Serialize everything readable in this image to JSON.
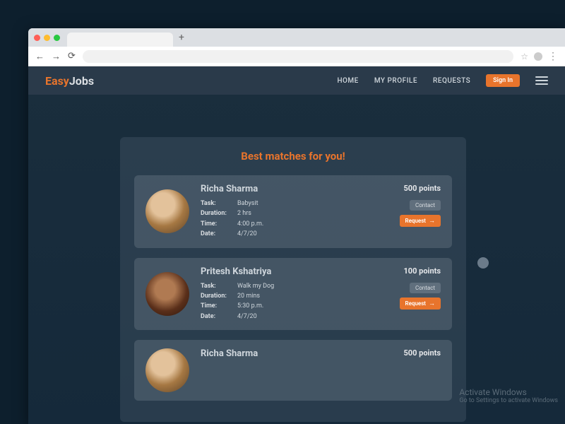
{
  "browser": {
    "new_tab_glyph": "+",
    "back": "←",
    "fwd": "→",
    "reload": "⟳",
    "star": "☆",
    "kebab": "⋮"
  },
  "nav": {
    "logo_easy": "Easy",
    "logo_jobs": "Jobs",
    "links": [
      "HOME",
      "MY PROFILE",
      "REQUESTS"
    ],
    "signin": "Sign In"
  },
  "headline": "Best matches for you!",
  "cards": [
    {
      "name": "Richa Sharma",
      "task": "Babysit",
      "duration": "2 hrs",
      "time": "4:00 p.m.",
      "date": "4/7/20",
      "points": "500 points",
      "contact": "Contact",
      "request": "Request"
    },
    {
      "name": "Pritesh Kshatriya",
      "task": "Walk my Dog",
      "duration": "20 mins",
      "time": "5:30 p.m.",
      "date": "4/7/20",
      "points": "100 points",
      "contact": "Contact",
      "request": "Request"
    },
    {
      "name": "Richa Sharma",
      "task": "",
      "duration": "",
      "time": "",
      "date": "",
      "points": "500 points",
      "contact": "",
      "request": ""
    }
  ],
  "labels": {
    "task": "Task:",
    "duration": "Duration:",
    "time": "Time:",
    "date": "Date:"
  },
  "watermark": {
    "title": "Activate Windows",
    "sub": "Go to Settings to activate Windows"
  }
}
